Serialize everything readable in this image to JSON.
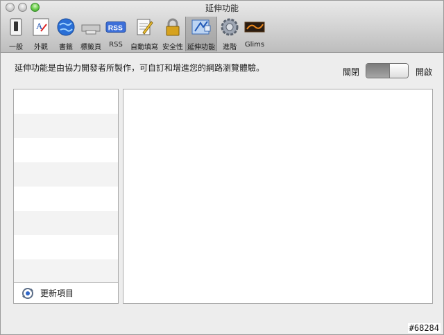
{
  "window": {
    "title": "延伸功能"
  },
  "toolbar": {
    "items": [
      {
        "label": "一般",
        "icon": "switch-icon"
      },
      {
        "label": "外觀",
        "icon": "font-icon"
      },
      {
        "label": "書籤",
        "icon": "globe-icon"
      },
      {
        "label": "標籤頁",
        "icon": "tab-icon"
      },
      {
        "label": "RSS",
        "icon": "rss-icon"
      },
      {
        "label": "自動填寫",
        "icon": "pencil-icon"
      },
      {
        "label": "安全性",
        "icon": "lock-icon"
      },
      {
        "label": "延伸功能",
        "icon": "puzzle-icon",
        "selected": true
      },
      {
        "label": "進階",
        "icon": "gear-icon"
      },
      {
        "label": "Glims",
        "icon": "glims-icon"
      }
    ]
  },
  "main": {
    "description": "延伸功能是由協力開發者所製作，可自訂和增進您的網路瀏覽體驗。",
    "toggle": {
      "off_label": "關閉",
      "on_label": "開啟",
      "state": "off"
    },
    "list": {
      "footer_label": "更新項目"
    }
  },
  "watermark": "#68284"
}
